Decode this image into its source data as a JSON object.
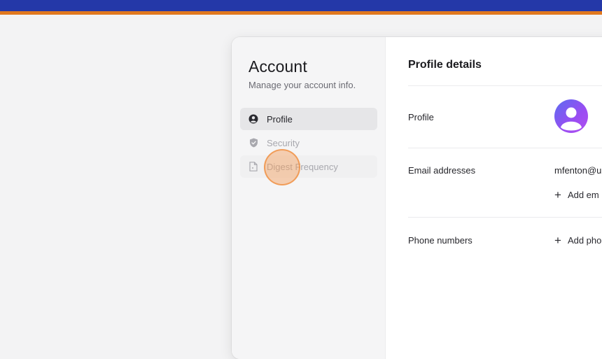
{
  "sidebar": {
    "title": "Account",
    "subtitle": "Manage your account info.",
    "items": [
      {
        "label": "Profile",
        "icon": "user-circle-icon",
        "state": "active"
      },
      {
        "label": "Security",
        "icon": "shield-icon",
        "state": "muted"
      },
      {
        "label": "Digest Frequency",
        "icon": "document-icon",
        "state": "hovered"
      }
    ]
  },
  "main": {
    "title": "Profile details",
    "profile_label": "Profile",
    "email_label": "Email addresses",
    "email_value": "mfenton@u",
    "add_email_label": "Add em",
    "phone_label": "Phone numbers",
    "add_phone_label": "Add pho"
  },
  "colors": {
    "topbar": "#2438a8",
    "topbar_stripe": "#e0781f",
    "avatar_gradient_start": "#5b6cf0",
    "avatar_gradient_end": "#b14ff0",
    "click_indicator": "#f59e5a"
  }
}
